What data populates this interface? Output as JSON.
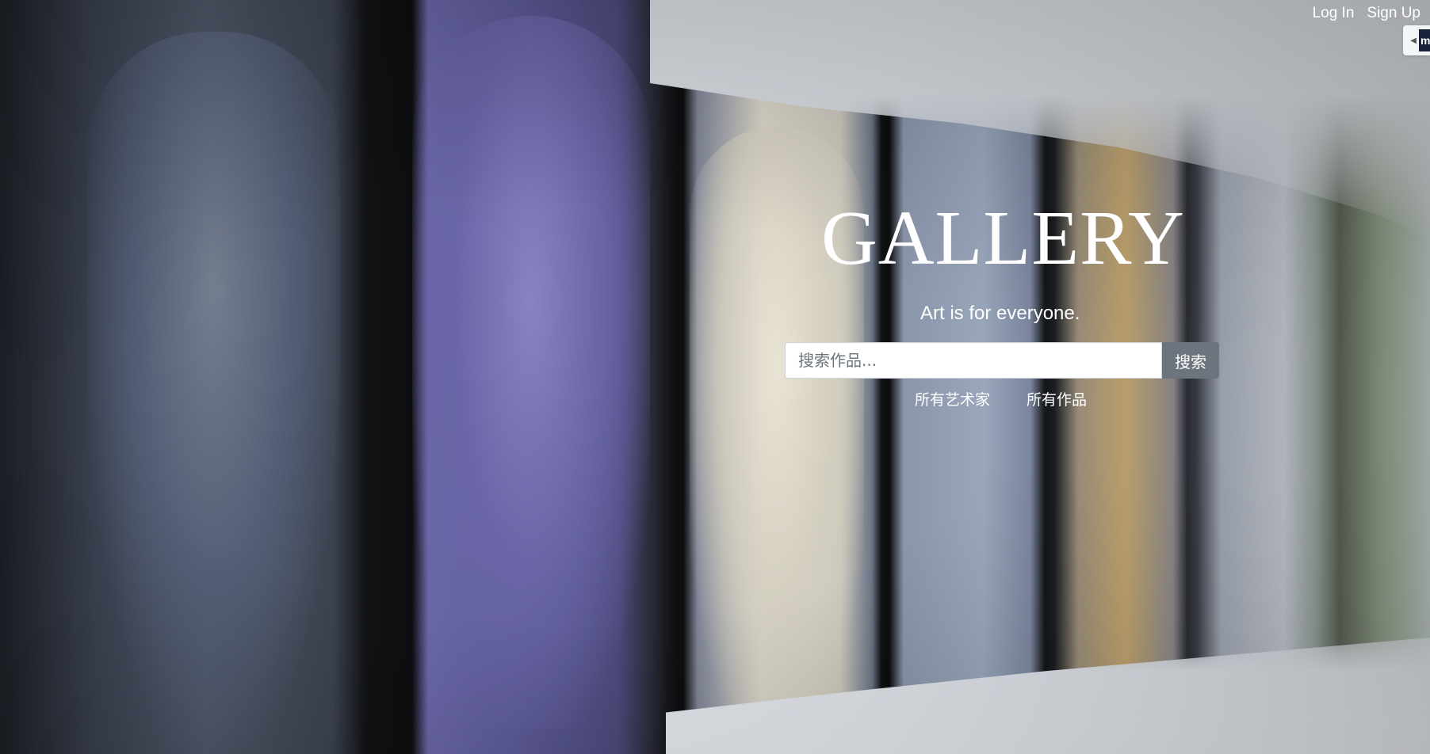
{
  "header": {
    "login_label": "Log In",
    "signup_label": "Sign Up"
  },
  "hero": {
    "title": "GALLERY",
    "tagline": "Art is for everyone."
  },
  "search": {
    "placeholder": "搜索作品...",
    "value": "",
    "button_label": "搜索"
  },
  "nav": {
    "artists_label": "所有艺术家",
    "works_label": "所有作品"
  },
  "side_tab": {
    "badge_text": "m"
  },
  "colors": {
    "search_button": "#6c757d",
    "text": "#ffffff"
  }
}
